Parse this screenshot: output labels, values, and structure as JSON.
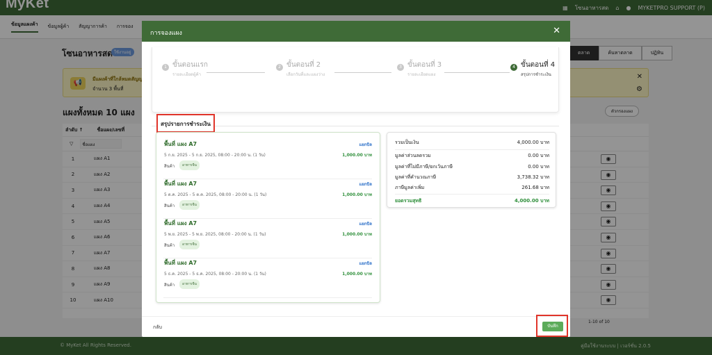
{
  "app": {
    "logo": "MyKet"
  },
  "topbar": {
    "items": [
      "โซนอาหารสด",
      "MYKETPRO SUPPORT (P)"
    ]
  },
  "subnav": {
    "tabs": [
      "ข้อมูลแผงค้า",
      "ข้อมูลผู้ค้า",
      "สัญญาการค้า",
      "การจอง"
    ]
  },
  "zone": {
    "title": "โซนอาหารสด",
    "badge": "ใช้งานอยู่"
  },
  "right_tabs": [
    "ตลาด",
    "ค้นหาตลาด",
    "ปฏิทิน"
  ],
  "alert": {
    "title": "มีแผงค้าที่ใกล้หมดสัญญา",
    "count": "จำนวน 3 พื้นที่"
  },
  "booths": {
    "title": "แผงทั้งหมด 10 แผง",
    "filter_button": "ตัวกรองแผง",
    "headers": [
      "ลำดับ ↑",
      "ชื่อแผง/เลขที่"
    ],
    "filter_placeholder": "ชื่อแผง",
    "rows": [
      {
        "no": "1",
        "name": "แผง A1"
      },
      {
        "no": "2",
        "name": "แผง A2"
      },
      {
        "no": "3",
        "name": "แผง A3"
      },
      {
        "no": "4",
        "name": "แผง A4"
      },
      {
        "no": "5",
        "name": "แผง A5"
      },
      {
        "no": "6",
        "name": "แผง A6"
      },
      {
        "no": "7",
        "name": "แผง A7"
      },
      {
        "no": "8",
        "name": "แผง A8"
      },
      {
        "no": "9",
        "name": "แผง A9"
      },
      {
        "no": "10",
        "name": "แผง A10"
      }
    ],
    "pager": "1-10 of 10"
  },
  "footer": {
    "left": "© MyKet All Rights Reserved.",
    "right": "คู่มือใช้งานระบบ | เวอร์ชั่น 2.0.5"
  },
  "modal": {
    "title": "การจองแผง",
    "steps": [
      {
        "num": "1",
        "name": "ขั้นตอนแรก",
        "desc": "รายละเอียดผู้ค้า"
      },
      {
        "num": "2",
        "name": "ขั้นตอนที่ 2",
        "desc": "เลือกวันที่และแผงว่าง"
      },
      {
        "num": "3",
        "name": "ขั้นตอนที่ 3",
        "desc": "รายละเอียดแผง"
      },
      {
        "num": "4",
        "name": "ขั้นตอนที่ 4",
        "desc": "สรุปการชำระเงิน"
      }
    ],
    "summary_title": "สรุปรายการชำระเงิน",
    "bookings": [
      {
        "name": "พื้นที่ แผง A7",
        "type": "แยกบิล",
        "date": "5 ก.ย. 2025 - 5 ก.ย. 2025, 08:00 - 20:00 น. (1 วัน)",
        "price": "1,000.00 บาท",
        "cat_label": "สินค้า",
        "tag": "อาหารจีน"
      },
      {
        "name": "พื้นที่ แผง A7",
        "type": "แยกบิล",
        "date": "5 ต.ค. 2025 - 5 ต.ค. 2025, 08:00 - 20:00 น. (1 วัน)",
        "price": "1,000.00 บาท",
        "cat_label": "สินค้า",
        "tag": "อาหารจีน"
      },
      {
        "name": "พื้นที่ แผง A7",
        "type": "แยกบิล",
        "date": "5 พ.ย. 2025 - 5 พ.ย. 2025, 08:00 - 20:00 น. (1 วัน)",
        "price": "1,000.00 บาท",
        "cat_label": "สินค้า",
        "tag": "อาหารจีน"
      },
      {
        "name": "พื้นที่ แผง A7",
        "type": "แยกบิล",
        "date": "5 ธ.ค. 2025 - 5 ธ.ค. 2025, 08:00 - 20:00 น. (1 วัน)",
        "price": "1,000.00 บาท",
        "cat_label": "สินค้า",
        "tag": "อาหารจีน"
      }
    ],
    "totals": {
      "subtotal_label": "รวมเป็นเงิน",
      "subtotal": "4,000.00 บาท",
      "discount_label": "มูลค่าส่วนลดรวม",
      "discount": "0.00 บาท",
      "nonvat_label": "มูลค่าที่ไม่มีภาษี/ยกเว้นภาษี",
      "nonvat": "0.00 บาท",
      "taxable_label": "มูลค่าที่คำนวณภาษี",
      "taxable": "3,738.32 บาท",
      "vat_label": "ภาษีมูลค่าเพิ่ม",
      "vat": "261.68 บาท",
      "net_label": "ยอดรวมสุทธิ",
      "net": "4,000.00 บาท"
    },
    "back_label": "กลับ",
    "save_label": "บันทึก"
  },
  "colors": {
    "brand": "#3f6b37",
    "highlight": "#e0342a",
    "price": "#2f8f3b",
    "billing": "#2b6fc8"
  }
}
